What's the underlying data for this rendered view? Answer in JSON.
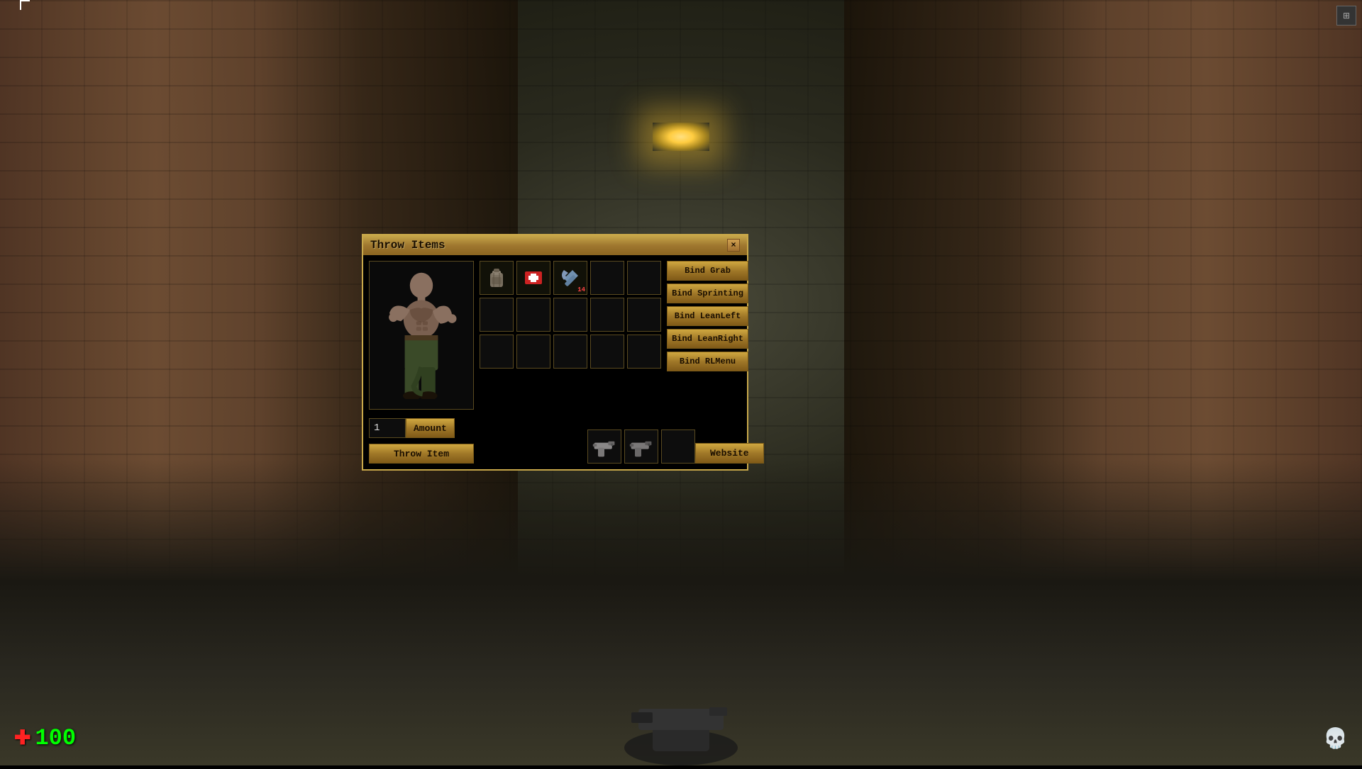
{
  "game": {
    "title": "Throw Items",
    "close_label": "×",
    "hud": {
      "health_icon": "✚",
      "health_value": "100",
      "skull_icon": "💀"
    }
  },
  "dialog": {
    "title": "Throw Items",
    "close_label": "×",
    "inventory_rows": [
      [
        {
          "has_item": true,
          "type": "backpack",
          "badge": ""
        },
        {
          "has_item": true,
          "type": "medkit",
          "badge": ""
        },
        {
          "has_item": true,
          "type": "wrench",
          "badge": "14"
        },
        {
          "has_item": false,
          "type": "",
          "badge": ""
        },
        {
          "has_item": false,
          "type": "",
          "badge": ""
        }
      ],
      [
        {
          "has_item": false
        },
        {
          "has_item": false
        },
        {
          "has_item": false
        },
        {
          "has_item": false
        },
        {
          "has_item": false
        }
      ],
      [
        {
          "has_item": false
        },
        {
          "has_item": false
        },
        {
          "has_item": false
        },
        {
          "has_item": false
        },
        {
          "has_item": false
        }
      ]
    ],
    "buttons": [
      {
        "label": "Bind Grab",
        "id": "bind-grab"
      },
      {
        "label": "Bind Sprinting",
        "id": "bind-sprinting"
      },
      {
        "label": "Bind LeanLeft",
        "id": "bind-leanleft"
      },
      {
        "label": "Bind LeanRight",
        "id": "bind-leanright"
      },
      {
        "label": "Bind RLMenu",
        "id": "bind-rlmenu"
      }
    ],
    "amount_value": "1",
    "amount_label": "Amount",
    "throw_button": "Throw Item",
    "website_button": "Website",
    "weapon_slots": [
      {
        "has_item": true,
        "type": "pistol"
      },
      {
        "has_item": true,
        "type": "pistol2"
      },
      {
        "has_item": false
      }
    ]
  }
}
